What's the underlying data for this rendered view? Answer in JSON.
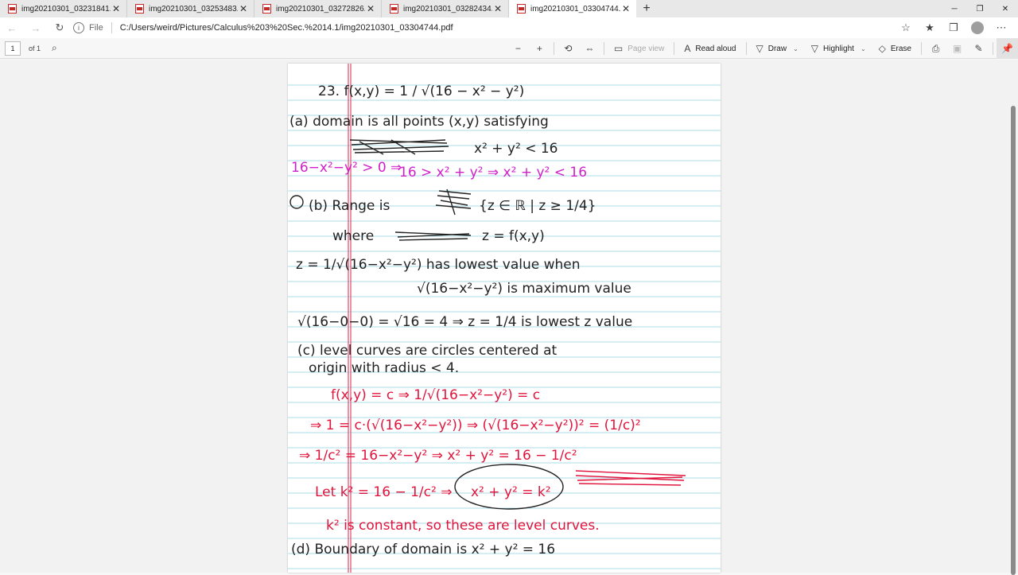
{
  "tabs": [
    {
      "label": "img20210301_03231841.pdf",
      "active": false
    },
    {
      "label": "img20210301_03253483.pdf",
      "active": false
    },
    {
      "label": "img20210301_03272826.pdf",
      "active": false
    },
    {
      "label": "img20210301_03282434.pdf",
      "active": false
    },
    {
      "label": "img20210301_03304744.pdf",
      "active": true
    }
  ],
  "window_controls": {
    "minimize": "─",
    "restore": "❐",
    "close": "✕"
  },
  "address_bar": {
    "scheme_label": "File",
    "url": "C:/Users/weird/Pictures/Calculus%203%20Sec.%2014.1/img20210301_03304744.pdf"
  },
  "pdf_toolbar": {
    "page_number": "1",
    "page_count": "of 1",
    "page_view": "Page view",
    "read_aloud": "Read aloud",
    "draw": "Draw",
    "highlight": "Highlight",
    "erase": "Erase"
  },
  "notes": {
    "l1": "23. f(x,y) = 1 / √(16 − x² − y²)",
    "l2": "(a) domain is all points (x,y) satisfying",
    "l3": "x² + y² < 16",
    "l4": "16−x²−y² > 0 ⇒",
    "l4b": "16 > x² + y² ⇒   x² + y² < 16",
    "l5": "(b) Range is",
    "l5b": "{z ∈ ℝ | z ≥ 1/4}",
    "l6": "where",
    "l6b": "z = f(x,y)",
    "l7": "z = 1/√(16−x²−y²)   has lowest value when",
    "l8": "√(16−x²−y²)   is maximum value",
    "l9": "√(16−0−0) = √16 = 4 ⇒  z = 1/4  is lowest z value",
    "l10": "(c) level curves are circles centered at",
    "l11": "origin with radius < 4.",
    "l12": "f(x,y) = c ⇒ 1/√(16−x²−y²) = c",
    "l13": "⇒ 1 = c·(√(16−x²−y²)) ⇒ (√(16−x²−y²))² = (1/c)²",
    "l14": "⇒ 1/c² = 16−x²−y² ⇒  x² + y² = 16 − 1/c²",
    "l15": "Let k² = 16 − 1/c²  ⇒",
    "l15b": "x² + y² = k²",
    "l16": "k² is constant, so these are level curves.",
    "l17": "(d) Boundary of domain is x² + y² = 16"
  }
}
